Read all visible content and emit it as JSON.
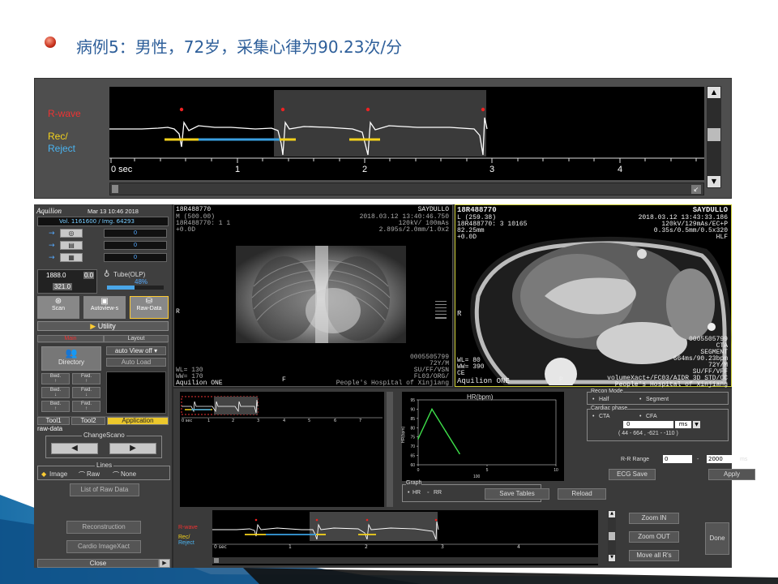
{
  "slide": {
    "title": "病例5：男性，72岁，采集心律为90.23次/分"
  },
  "ecg_top": {
    "rwave_label": "R-wave",
    "rec_label": "Rec/",
    "reject_label": "Reject",
    "time_ticks": [
      "0 sec",
      "1",
      "2",
      "3",
      "4"
    ]
  },
  "console": {
    "brand": "Aquilion",
    "datetime": "Mar 13 10:46 2018",
    "vol_img": "Vol. 1161600 / Img. 64293",
    "counters": [
      "0",
      "0",
      "0"
    ],
    "kv_value": "1888.0",
    "kv_sub": "321.0",
    "kv_side": "0.0",
    "tube_label": "Tube(OLP)",
    "tube_pct": "48%",
    "tube_level": 0.48,
    "mode_buttons": [
      "Scan",
      "Autoview-s",
      "Raw-Data"
    ],
    "utility": "Utility",
    "tabs_main": "Main",
    "tabs_layout": "Layout",
    "directory": "Directory",
    "auto_view": "auto View off",
    "auto_load": "Auto Load",
    "bwd_fwd": [
      "Bwd.",
      "Fwd.",
      "Bwd.",
      "Fwd.",
      "Bwd.",
      "Fwd."
    ],
    "tools": [
      "Tool1",
      "Tool2",
      "Application"
    ],
    "raw_data_label": "raw-data",
    "change_scano": "ChangeScano",
    "lines_label": "Lines",
    "lines_opts": [
      "Image",
      "Raw",
      "None"
    ],
    "list_raw": "List of Raw Data",
    "reconstruction": "Reconstruction",
    "cardio_xact": "Cardio ImageXact",
    "close": "Close"
  },
  "viewer_left": {
    "id": "18R488770",
    "name": "SAYDULLO",
    "line2": "M (500.00)",
    "line3": "18R488770: 1 1",
    "line4": "+0.0D",
    "date": "2018.03.12 13:40:46.750",
    "kv": "120kV/ 100mAs",
    "thick": "2.895s/2.0mm/1.0x2",
    "r_mark": "R",
    "f_mark": "F",
    "pid": "0005505799",
    "age": "72Y/M",
    "su": "SU/FF/VSN",
    "fl": "FL03/ORG/",
    "wl": "WL= 130",
    "ww": "WW= 170",
    "brand": "Aquilion ONE",
    "hosp": "People's Hospital of Xinjiang"
  },
  "viewer_right": {
    "id": "18R488770",
    "name": "SAYDULLO",
    "line2": "L (259.38)",
    "line3": "18R488770: 3 10165",
    "line4": "82.25mm",
    "line5": "+0.0D",
    "date": "2018.03.12 13:43:33.186",
    "kv": "120kV/129mAs/EC+P",
    "thick": "0.35s/0.5mm/0.5x320",
    "hlf": "HLF",
    "r_mark": "R",
    "p_mark": "P",
    "pid": "0005505799",
    "cta": "CTA",
    "segment": "SEGMENT",
    "ms": "664ms/90.23bpm",
    "age": "72Y/M",
    "su": "SU/FF/VFF",
    "vx": "volumeXact+/FC03/AIDR 3D STD/CC",
    "wl": "WL= 80",
    "ww": "WW= 390",
    "ce": "CE",
    "brand": "Aquilion ONE",
    "hosp": "People's Hospital of Xinjiang"
  },
  "hr_chart": {
    "title": "HR(bpm)",
    "ylabel": "HR(bpm)",
    "xlabel": "100",
    "yticks": [
      "95",
      "90",
      "85",
      "80",
      "75",
      "70",
      "65",
      "60"
    ],
    "xticks": [
      "0",
      "5",
      "10"
    ],
    "graph_label": "Graph",
    "graph_opts": [
      "HR",
      "RR"
    ],
    "save_tables": "Save Tables",
    "reload": "Reload"
  },
  "chart_data": {
    "type": "line",
    "title": "HR(bpm)",
    "ylabel": "HR(bpm)",
    "x": [
      0,
      1,
      2,
      3
    ],
    "values": [
      74,
      90,
      78,
      66
    ],
    "ylim": [
      60,
      95
    ],
    "xlim": [
      0,
      10
    ]
  },
  "recon": {
    "mode_label": "Recon Mode",
    "half": "Half",
    "segment": "Segment",
    "cardiac_label": "Cardiac phase",
    "cta": "CTA",
    "cfa": "CFA",
    "phase_val": "0",
    "phase_unit": "ms",
    "range": "( 44 - 664 , -621 - -110 )",
    "rr_label": "R-R Range",
    "rr_from": "0",
    "rr_to": "2000",
    "rr_unit": "ms",
    "ecg_save": "ECG Save",
    "apply": "Apply"
  },
  "ecg_bottom": {
    "rwave_label": "R-wave",
    "rec_label": "Rec/",
    "reject_label": "Reject",
    "time_ticks": [
      "0 sec",
      "1",
      "2",
      "3",
      "4"
    ],
    "zoom_in": "Zoom IN",
    "zoom_out": "Zoom OUT",
    "move_all": "Move all R's",
    "done": "Done"
  },
  "mini_ecg_ticks": [
    "0 sec",
    "1",
    "2",
    "3",
    "4",
    "5",
    "6",
    "7"
  ]
}
